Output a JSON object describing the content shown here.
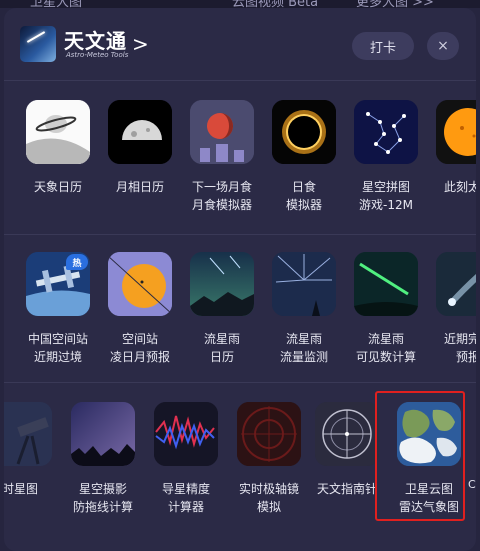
{
  "top_strip": {
    "left_text": "卫星大图",
    "middle_text": "云图视频 Beta",
    "right_text": "更多大图 >>"
  },
  "header": {
    "brand_name": "天文通",
    "brand_sub": "Astro-Meteo Tools",
    "chevron": ">",
    "checkin_label": "打卡",
    "close_label": "×"
  },
  "row1": [
    {
      "label": "天象日历",
      "icon": "saturn-icon"
    },
    {
      "label": "月相日历",
      "icon": "moon-phase-icon"
    },
    {
      "label": "下一场月食\n月食模拟器",
      "icon": "lunar-eclipse-icon"
    },
    {
      "label": "日食\n模拟器",
      "icon": "solar-eclipse-icon"
    },
    {
      "label": "星空拼图\n游戏-12M",
      "icon": "constellation-icon"
    },
    {
      "label": "此刻太阳",
      "icon": "sun-now-icon"
    }
  ],
  "row2": [
    {
      "label": "中国空间站\n近期过境",
      "icon": "space-station-icon",
      "badge": "热"
    },
    {
      "label": "空间站\n凌日月预报",
      "icon": "station-transit-icon"
    },
    {
      "label": "流星雨\n日历",
      "icon": "meteor-calendar-icon"
    },
    {
      "label": "流星雨\n流量监测",
      "icon": "meteor-monitor-icon"
    },
    {
      "label": "流星雨\n可见数计算",
      "icon": "meteor-count-icon"
    },
    {
      "label": "近期完整\n预报",
      "icon": "comet-forecast-icon"
    }
  ],
  "row3": [
    {
      "label": "时星图",
      "icon": "telescope-icon"
    },
    {
      "label": "星空摄影\n防拖线计算",
      "icon": "star-photo-icon"
    },
    {
      "label": "导星精度\n计算器",
      "icon": "guiding-graph-icon"
    },
    {
      "label": "实时极轴镜\n模拟",
      "icon": "polar-scope-icon"
    },
    {
      "label": "天文指南针",
      "icon": "compass-icon"
    },
    {
      "label": "卫星云图\n雷达气象图",
      "icon": "satellite-cloud-icon"
    }
  ],
  "row3_edge_text": "C",
  "colors": {
    "panel": "#2b2a46",
    "highlight": "#e0201f",
    "badge": "#2a6fe0"
  }
}
